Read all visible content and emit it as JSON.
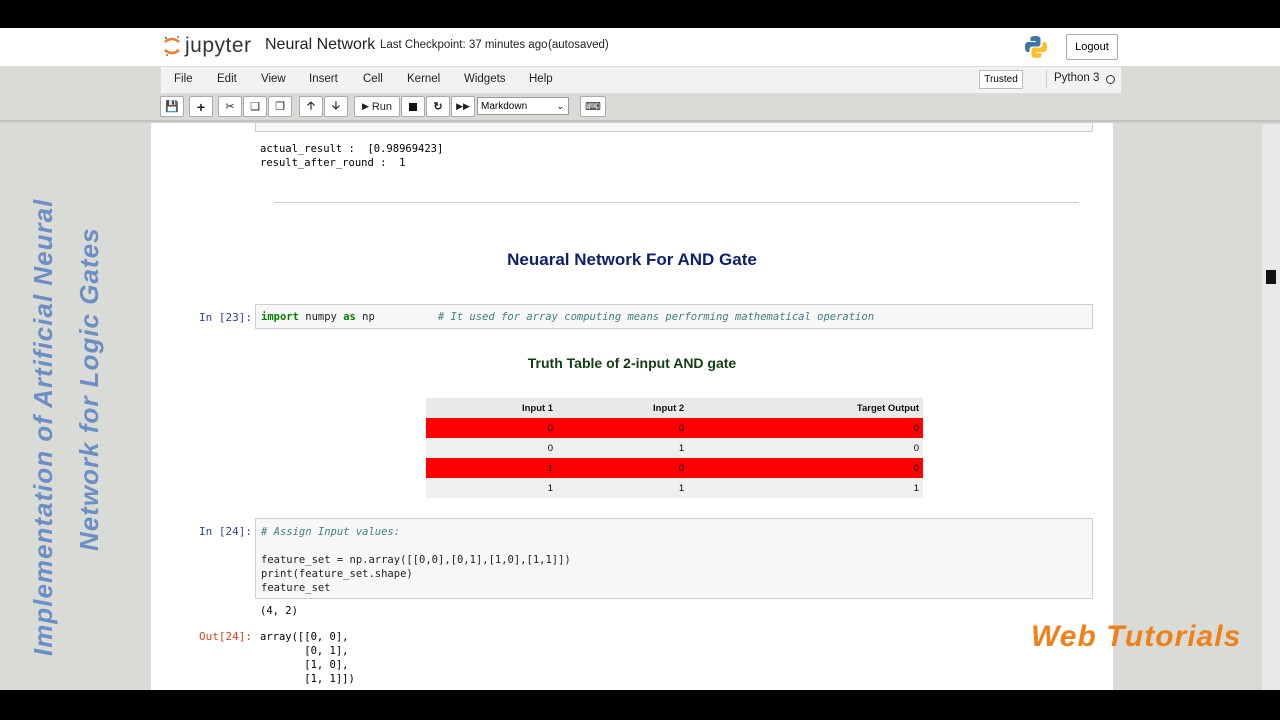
{
  "header": {
    "logo_text": "jupyter",
    "notebook_title": "Neural Network",
    "checkpoint": "Last Checkpoint: 37 minutes ago",
    "autosaved": "(autosaved)",
    "logout": "Logout"
  },
  "menu": {
    "items": [
      "File",
      "Edit",
      "View",
      "Insert",
      "Cell",
      "Kernel",
      "Widgets",
      "Help"
    ],
    "trusted": "Trusted",
    "kernel": "Python 3"
  },
  "toolbar": {
    "run_label": "Run",
    "cell_type": "Markdown"
  },
  "notebook": {
    "prev_output_line1": "actual_result :  [0.98969423]",
    "prev_output_line2": "result_after_round :  1",
    "heading1": "Neuaral Network For AND Gate",
    "cell23_prompt": "In [23]:",
    "cell23_code_kw": "import",
    "cell23_code_mid": " numpy ",
    "cell23_code_as": "as",
    "cell23_code_end": " np",
    "cell23_comment": "# It used for array computing means performing mathematical operation",
    "heading2": "Truth Table of 2-input AND gate",
    "table": {
      "headers": [
        "Input 1",
        "Input 2",
        "Target Output"
      ],
      "rows": [
        [
          "0",
          "0",
          "0"
        ],
        [
          "0",
          "1",
          "0"
        ],
        [
          "1",
          "0",
          "0"
        ],
        [
          "1",
          "1",
          "1"
        ]
      ]
    },
    "cell24_prompt": "In [24]:",
    "cell24_comment": "# Assign Input values:",
    "cell24_line2": "feature_set = np.array([[0,0],[0,1],[1,0],[1,1]])",
    "cell24_line3": "print(feature_set.shape)",
    "cell24_line4": "feature_set",
    "cell24_stdout": "(4, 2)",
    "out24_prompt": "Out[24]:",
    "out24_lines": [
      "array([[0, 0],",
      "       [0, 1],",
      "       [1, 0],",
      "       [1, 1]])"
    ]
  },
  "overlay": {
    "side_line1": "Implementation of Artificial Neural",
    "side_line2": "Network for Logic Gates",
    "watermark": "Web Tutorials"
  },
  "colors": {
    "row_highlight": "#ff0000",
    "side_text": "#6d8ec4",
    "watermark": "#f0801a"
  }
}
